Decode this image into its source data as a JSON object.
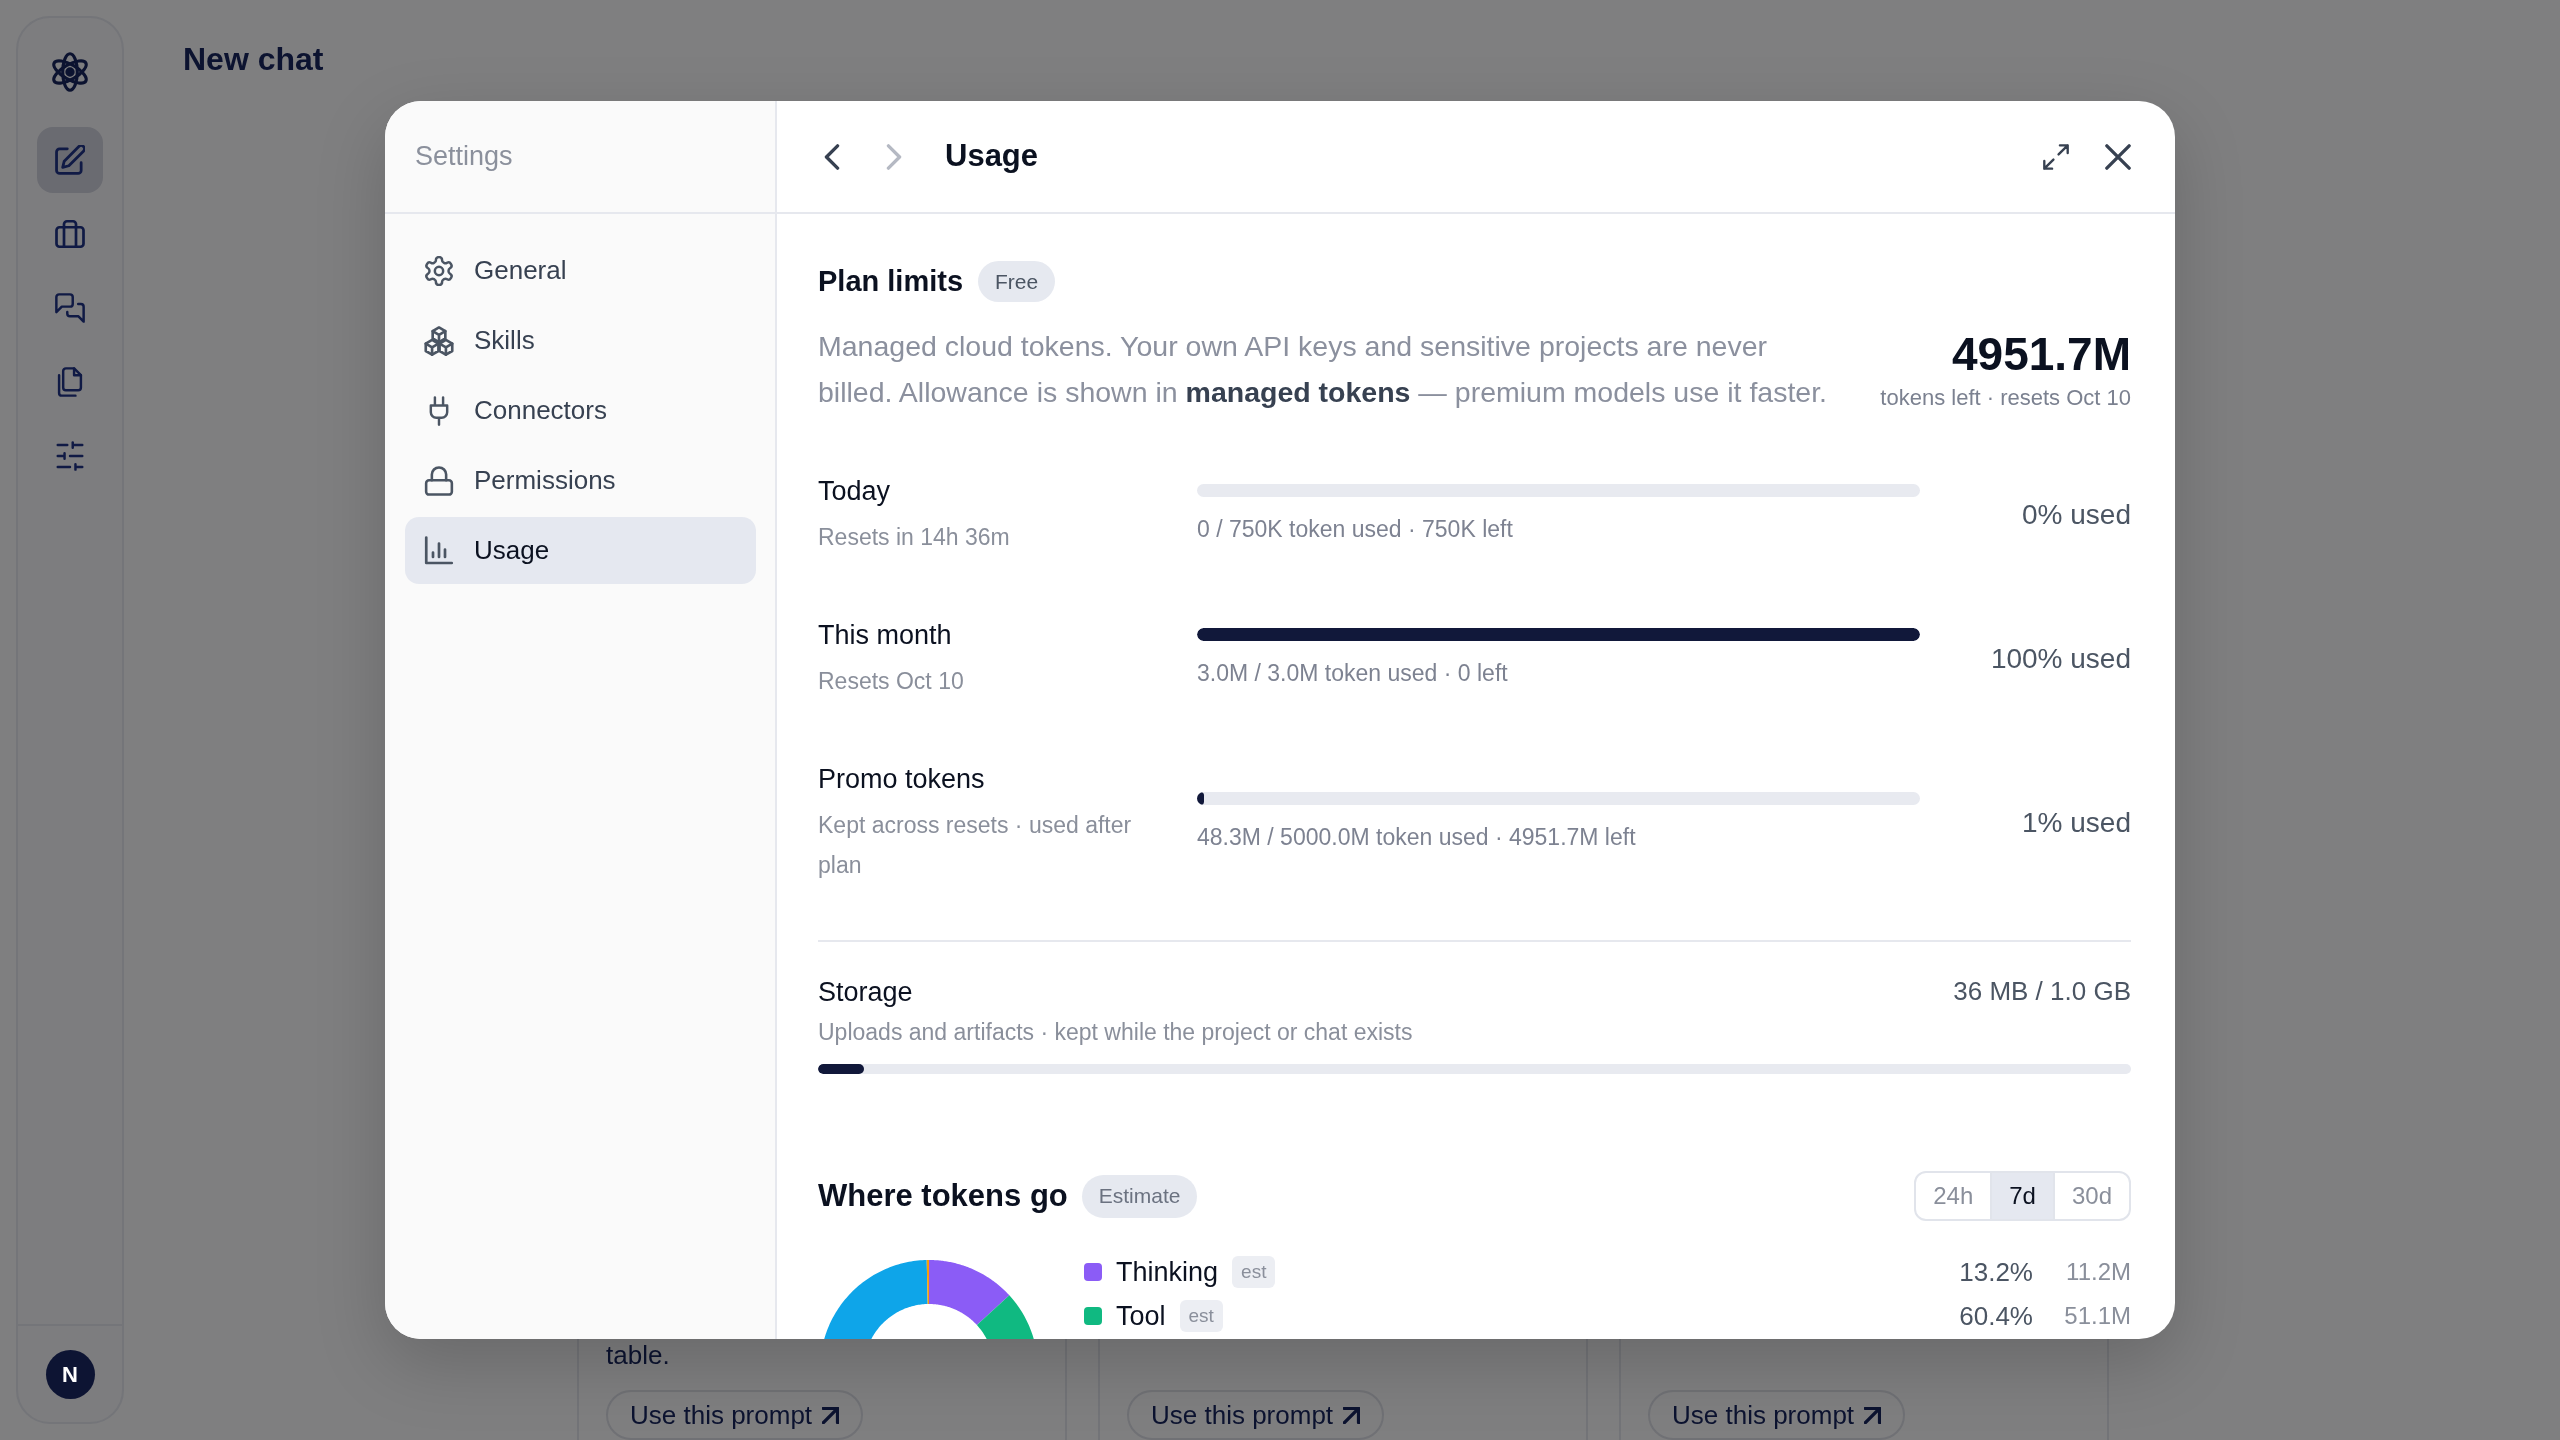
{
  "rail": {
    "items": [
      {
        "selected": true
      },
      {
        "selected": false
      },
      {
        "selected": false
      },
      {
        "selected": false
      },
      {
        "selected": false
      }
    ],
    "avatar": "N"
  },
  "page": {
    "title": "New chat",
    "cards": [
      {
        "text": "table.",
        "button": "Use this prompt"
      },
      {
        "button": "Use this prompt"
      },
      {
        "button": "Use this prompt"
      }
    ]
  },
  "settings": {
    "title": "Settings",
    "nav": [
      {
        "label": "General",
        "selected": false
      },
      {
        "label": "Skills",
        "selected": false
      },
      {
        "label": "Connectors",
        "selected": false
      },
      {
        "label": "Permissions",
        "selected": false
      },
      {
        "label": "Usage",
        "selected": true
      }
    ]
  },
  "panel": {
    "title": "Usage",
    "back": {
      "disabled": false
    },
    "forward": {
      "disabled": true
    }
  },
  "plan": {
    "title": "Plan limits",
    "badge": "Free",
    "description": "Managed cloud tokens. Your own API keys and sensitive projects are never billed. Allowance is shown in **managed tokens** — premium models use it faster.",
    "tokens_left": "4951.7M",
    "tokens_caption": "tokens left · resets Oct 10"
  },
  "limits": [
    {
      "name": "Today",
      "note": "Resets in 14h 36m",
      "level": 0,
      "caption": "0 / 750K token used · 750K left",
      "reading": "0% used"
    },
    {
      "name": "This month",
      "note": "Resets Oct 10",
      "level": 1,
      "caption": "3.0M / 3.0M token used · 0 left",
      "reading": "100% used"
    },
    {
      "name": "Promo tokens",
      "note": "Kept across resets · used after plan",
      "level": 0.01,
      "caption": "48.3M / 5000.0M token used · 4951.7M left",
      "reading": "1% used"
    }
  ],
  "storage": {
    "title": "Storage",
    "reading": "36 MB / 1.0 GB",
    "note": "Uploads and artifacts · kept while the project or chat exists",
    "level": 0.035
  },
  "breakdown": {
    "title": "Where tokens go",
    "badge": "Estimate",
    "ranges": [
      {
        "label": "24h",
        "selected": false
      },
      {
        "label": "7d",
        "selected": true
      },
      {
        "label": "30d",
        "selected": false
      }
    ],
    "items": [
      {
        "label": "Thinking",
        "tag": "est",
        "color": "#8b5cf6",
        "share": "13.2%",
        "tokens": "11.2M"
      },
      {
        "label": "Tool",
        "tag": "est",
        "color": "#10b981",
        "share": "60.4%",
        "tokens": "51.1M"
      }
    ]
  }
}
